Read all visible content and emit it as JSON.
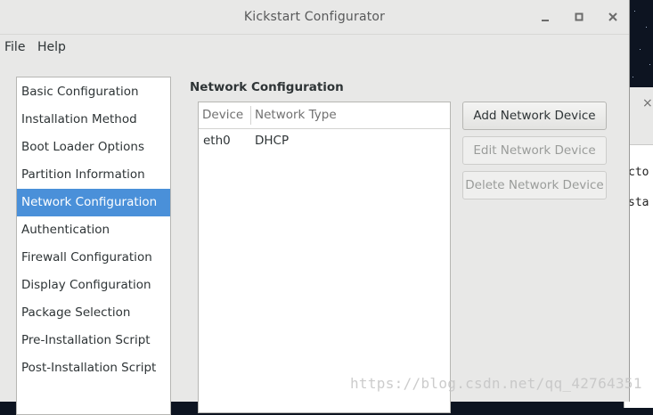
{
  "window": {
    "title": "Kickstart Configurator",
    "controls": {
      "minimize_icon": "minimize-icon",
      "maximize_icon": "maximize-icon",
      "close_icon": "close-icon"
    }
  },
  "menubar": {
    "items": [
      "File",
      "Help"
    ]
  },
  "sidebar": {
    "items": [
      "Basic Configuration",
      "Installation Method",
      "Boot Loader Options",
      "Partition Information",
      "Network Configuration",
      "Authentication",
      "Firewall Configuration",
      "Display Configuration",
      "Package Selection",
      "Pre-Installation Script",
      "Post-Installation Script"
    ],
    "selected": "Network Configuration"
  },
  "section": {
    "title": "Network Configuration"
  },
  "table": {
    "columns": [
      "Device",
      "Network Type"
    ],
    "rows": [
      {
        "device": "eth0",
        "network_type": "DHCP"
      }
    ]
  },
  "buttons": {
    "add": "Add Network Device",
    "edit": "Edit Network Device",
    "delete": "Delete Network Device"
  },
  "background_window": {
    "close": "×",
    "lines": [
      "cto",
      "sta"
    ]
  },
  "watermark": "https://blog.csdn.net/qq_42764351",
  "colors": {
    "selection": "#4a90d9",
    "window_bg": "#e8e8e7",
    "desktop_bg": "#0d1421"
  }
}
